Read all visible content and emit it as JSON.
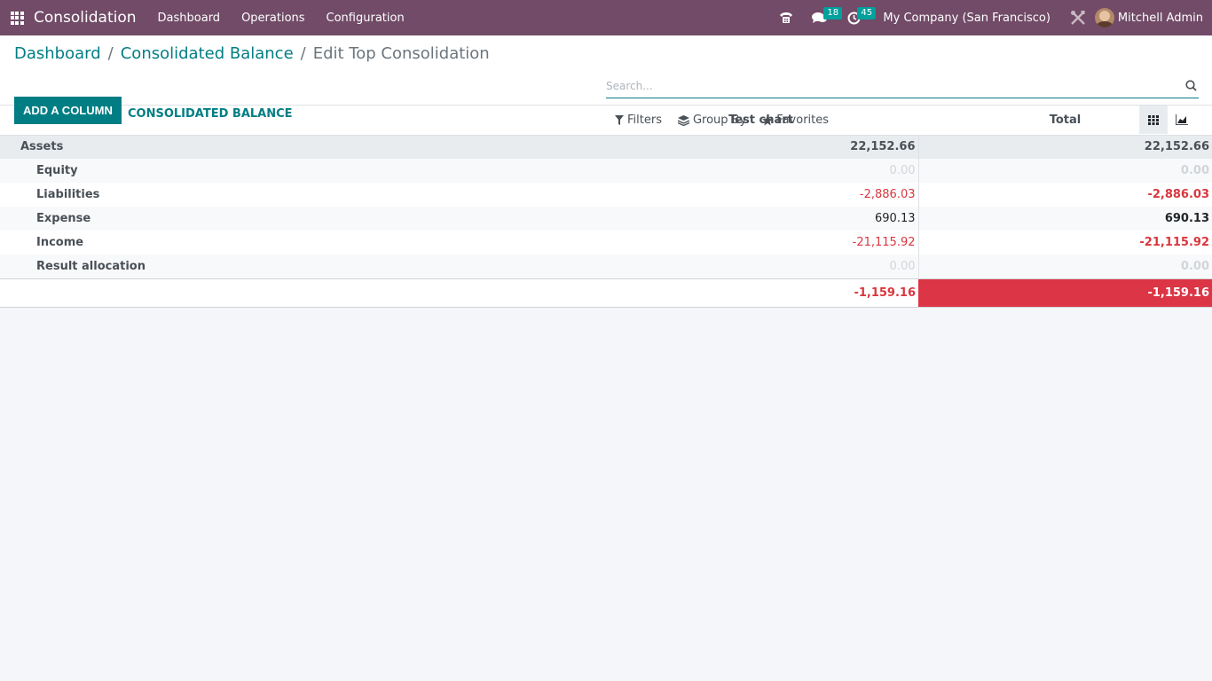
{
  "navbar": {
    "app_name": "Consolidation",
    "menu": [
      "Dashboard",
      "Operations",
      "Configuration"
    ],
    "messages_count": "18",
    "activities_count": "45",
    "company": "My Company (San Francisco)",
    "user": "Mitchell Admin",
    "bg_color": "#714b67"
  },
  "breadcrumb": {
    "items": [
      "Dashboard",
      "Consolidated Balance"
    ],
    "current": "Edit Top Consolidation"
  },
  "actions": {
    "add_column": "ADD A COLUMN",
    "consolidated_balance": "CONSOLIDATED BALANCE"
  },
  "search": {
    "placeholder": "Search..."
  },
  "filters": {
    "filters_label": "Filters",
    "group_by_label": "Group By",
    "favorites_label": "Favorites"
  },
  "views": [
    "grid-view-icon",
    "graph-view-icon"
  ],
  "table": {
    "columns": [
      "Test chart",
      "Total"
    ],
    "section": {
      "label": "Assets",
      "chart": "22,152.66",
      "total": "22,152.66"
    },
    "rows": [
      {
        "label": "Equity",
        "chart": "0.00",
        "total": "0.00",
        "kind": "zero"
      },
      {
        "label": "Liabilities",
        "chart": "-2,886.03",
        "total": "-2,886.03",
        "kind": "neg"
      },
      {
        "label": "Expense",
        "chart": "690.13",
        "total": "690.13",
        "kind": "pos"
      },
      {
        "label": "Income",
        "chart": "-21,115.92",
        "total": "-21,115.92",
        "kind": "neg"
      },
      {
        "label": "Result allocation",
        "chart": "0.00",
        "total": "0.00",
        "kind": "zero"
      }
    ],
    "footer": {
      "chart": "-1,159.16",
      "total": "-1,159.16"
    }
  },
  "colors": {
    "accent": "#017e84",
    "negative": "#d9363e",
    "total_highlight": "#dc3545"
  }
}
